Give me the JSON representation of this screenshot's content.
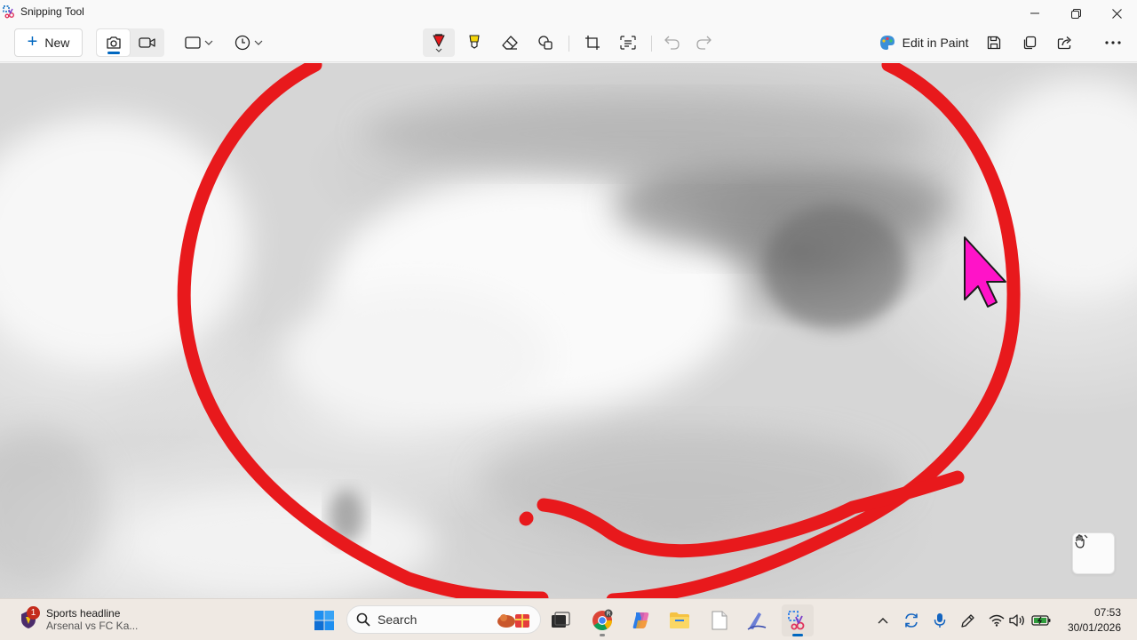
{
  "window": {
    "title": "Snipping Tool"
  },
  "toolbar": {
    "new_label": "New",
    "edit_in_paint_label": "Edit in Paint"
  },
  "icons": {
    "app": "scissors-icon",
    "minimize": "minimize-icon",
    "restore": "restore-icon",
    "close": "close-icon",
    "snip_photo": "camera-icon",
    "snip_video": "video-icon",
    "snip_shape": "rectangle-snip-icon",
    "delay": "timer-icon",
    "pen": "pen-icon",
    "highlighter": "highlighter-icon",
    "eraser": "eraser-icon",
    "shapes": "shapes-icon",
    "crop": "crop-icon",
    "text_actions": "text-actions-icon",
    "undo": "undo-icon",
    "redo": "redo-icon",
    "paint": "paint-icon",
    "save": "save-icon",
    "copy": "copy-icon",
    "share": "share-icon",
    "more": "more-icon"
  },
  "colors": {
    "pen_ink": "#e8191c",
    "cursor": "#ff13c8",
    "accent": "#0067c0"
  },
  "taskbar": {
    "news_badge": "1",
    "news_title": "Sports headline",
    "news_subtitle": "Arsenal vs FC Ka...",
    "search_placeholder": "Search",
    "clock_time": "07:53",
    "clock_date": "30/01/2026"
  }
}
